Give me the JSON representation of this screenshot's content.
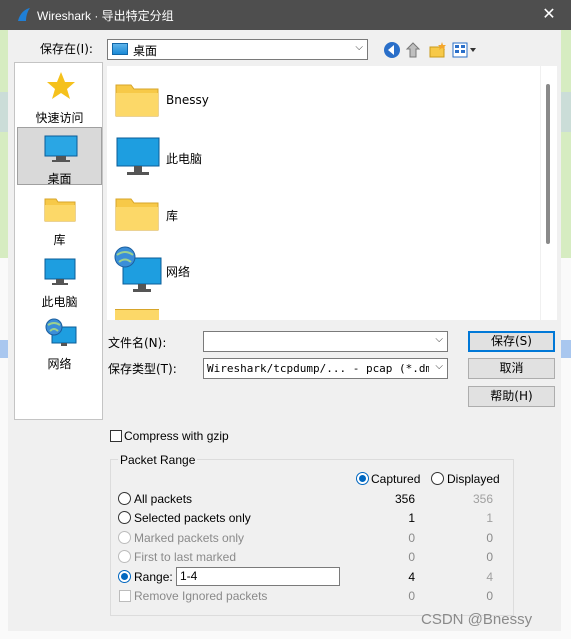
{
  "title": "Wireshark · 导出特定分组",
  "save_in": {
    "label": "保存在(I):",
    "value": "桌面"
  },
  "places": [
    {
      "label": "快速访问",
      "icon": "star-icon"
    },
    {
      "label": "桌面",
      "icon": "desktop-icon",
      "selected": true
    },
    {
      "label": "库",
      "icon": "folder-icon"
    },
    {
      "label": "此电脑",
      "icon": "monitor-icon"
    },
    {
      "label": "网络",
      "icon": "network-icon"
    }
  ],
  "files": [
    {
      "name": "Bnessy",
      "icon": "folder-icon"
    },
    {
      "name": "此电脑",
      "icon": "monitor-icon"
    },
    {
      "name": "库",
      "icon": "folder-icon"
    },
    {
      "name": "网络",
      "icon": "network-icon"
    }
  ],
  "filename": {
    "label": "文件名(N):",
    "value": ""
  },
  "filetype": {
    "label": "保存类型(T):",
    "value": "Wireshark/tcpdump/... - pcap (*.dmp.g"
  },
  "buttons": {
    "save": "保存(S)",
    "cancel": "取消",
    "help": "帮助(H)"
  },
  "compress": {
    "label": "Compress with gzip",
    "checked": false
  },
  "packet_range": {
    "title": "Packet Range",
    "captured_label": "Captured",
    "displayed_label": "Displayed",
    "rows": [
      {
        "label": "All packets",
        "captured": "356",
        "displayed": "356",
        "enabled": true,
        "selected": false
      },
      {
        "label": "Selected packets only",
        "captured": "1",
        "displayed": "1",
        "enabled": true,
        "selected": false
      },
      {
        "label": "Marked packets only",
        "captured": "0",
        "displayed": "0",
        "enabled": false,
        "selected": false
      },
      {
        "label": "First to last marked",
        "captured": "0",
        "displayed": "0",
        "enabled": false,
        "selected": false
      },
      {
        "label": "Range:",
        "captured": "4",
        "displayed": "4",
        "enabled": true,
        "selected": true,
        "value": "1-4"
      },
      {
        "label": "Remove Ignored packets",
        "captured": "0",
        "displayed": "0",
        "enabled": false,
        "checkbox": true
      }
    ]
  },
  "watermark": "CSDN @Bnessy",
  "colors": {
    "accent": "#0067c0",
    "titlebar": "#4e4e4e",
    "folder": "#f7c948"
  }
}
